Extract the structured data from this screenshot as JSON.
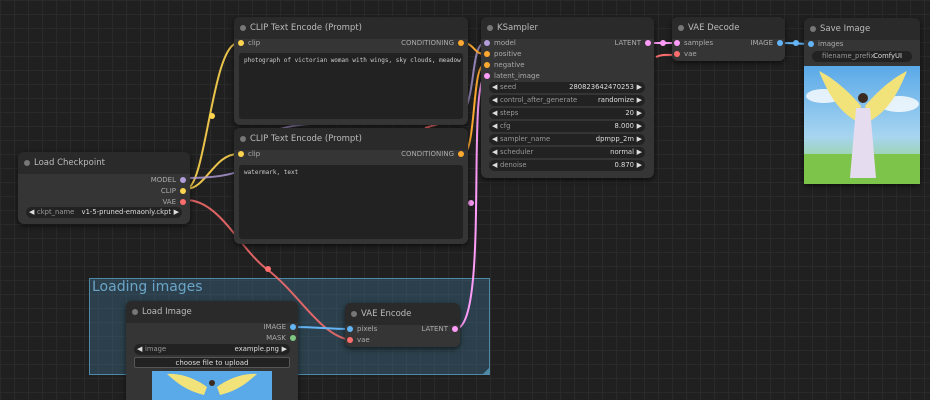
{
  "colors": {
    "model": "#b39ddb",
    "clip": "#ffd54f",
    "vae": "#ff6e6e",
    "conditioning": "#ffa931",
    "latent": "#ff9cf9",
    "image": "#64b5f6",
    "mask": "#81c784"
  },
  "group": {
    "title": "Loading images"
  },
  "load_checkpoint": {
    "title": "Load Checkpoint",
    "outputs": [
      "MODEL",
      "CLIP",
      "VAE"
    ],
    "ckpt_name_label": "ckpt_name",
    "ckpt_name_value": "v1-5-pruned-emaonly.ckpt"
  },
  "clip_pos": {
    "title": "CLIP Text Encode (Prompt)",
    "input": "clip",
    "output": "CONDITIONING",
    "text": "photograph of victorian woman with wings, sky clouds, meadow grass"
  },
  "clip_neg": {
    "title": "CLIP Text Encode (Prompt)",
    "input": "clip",
    "output": "CONDITIONING",
    "text": "watermark, text"
  },
  "ksampler": {
    "title": "KSampler",
    "inputs": [
      "model",
      "positive",
      "negative",
      "latent_image"
    ],
    "output": "LATENT",
    "widgets": [
      {
        "name": "seed",
        "value": "280823642470253"
      },
      {
        "name": "control_after_generate",
        "value": "randomize"
      },
      {
        "name": "steps",
        "value": "20"
      },
      {
        "name": "cfg",
        "value": "8.000"
      },
      {
        "name": "sampler_name",
        "value": "dpmpp_2m"
      },
      {
        "name": "scheduler",
        "value": "normal"
      },
      {
        "name": "denoise",
        "value": "0.870"
      }
    ]
  },
  "vae_decode": {
    "title": "VAE Decode",
    "inputs": [
      "samples",
      "vae"
    ],
    "output": "IMAGE"
  },
  "save_image": {
    "title": "Save Image",
    "input": "images",
    "prefix_label": "filename_prefix",
    "prefix_value": "ComfyUI"
  },
  "load_image": {
    "title": "Load Image",
    "outputs": [
      "IMAGE",
      "MASK"
    ],
    "image_label": "image",
    "image_value": "example.png",
    "upload_label": "choose file to upload"
  },
  "vae_encode": {
    "title": "VAE Encode",
    "inputs": [
      "pixels",
      "vae"
    ],
    "output": "LATENT"
  }
}
